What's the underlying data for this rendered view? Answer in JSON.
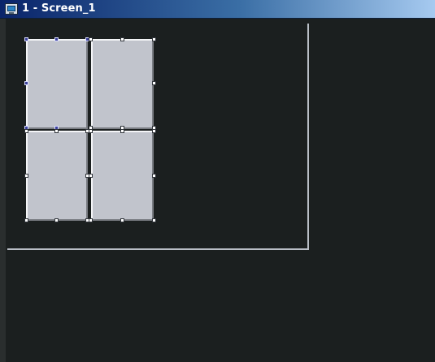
{
  "window": {
    "title": "1 - Screen_1",
    "icon": "screen-window-icon"
  },
  "colors": {
    "titlebar_start": "#0a246a",
    "titlebar_end": "#a6caf0",
    "canvas_background": "#1b1f1f",
    "object_fill": "#c1c4cc",
    "handle_white": "#ffffff",
    "handle_blue": "#3a3f9a"
  }
}
